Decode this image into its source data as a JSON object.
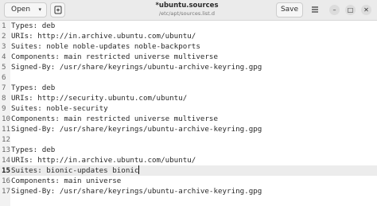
{
  "header": {
    "open_label": "Open",
    "title": "*ubuntu.sources",
    "subtitle": "/etc/apt/sources.list.d",
    "save_label": "Save",
    "minimize_glyph": "–",
    "maximize_glyph": "□",
    "close_glyph": "✕"
  },
  "icons": {
    "open_chevron": "chevron-down-icon",
    "new_tab": "new-tab-icon",
    "menu": "hamburger-menu-icon"
  },
  "editor": {
    "current_line": 15,
    "lines": [
      {
        "n": "1",
        "text": "Types: deb"
      },
      {
        "n": "2",
        "text": "URIs: http://in.archive.ubuntu.com/ubuntu/"
      },
      {
        "n": "3",
        "text": "Suites: noble noble-updates noble-backports"
      },
      {
        "n": "4",
        "text": "Components: main restricted universe multiverse"
      },
      {
        "n": "5",
        "text": "Signed-By: /usr/share/keyrings/ubuntu-archive-keyring.gpg"
      },
      {
        "n": "6",
        "text": ""
      },
      {
        "n": "7",
        "text": "Types: deb"
      },
      {
        "n": "8",
        "text": "URIs: http://security.ubuntu.com/ubuntu/"
      },
      {
        "n": "9",
        "text": "Suites: noble-security"
      },
      {
        "n": "10",
        "text": "Components: main restricted universe multiverse"
      },
      {
        "n": "11",
        "text": "Signed-By: /usr/share/keyrings/ubuntu-archive-keyring.gpg"
      },
      {
        "n": "12",
        "text": ""
      },
      {
        "n": "13",
        "text": "Types: deb"
      },
      {
        "n": "14",
        "text": "URIs: http://in.archive.ubuntu.com/ubuntu/"
      },
      {
        "n": "15",
        "text": "Suites: bionic-updates bionic"
      },
      {
        "n": "16",
        "text": "Components: main universe"
      },
      {
        "n": "17",
        "text": "Signed-By: /usr/share/keyrings/ubuntu-archive-keyring.gpg"
      }
    ]
  }
}
